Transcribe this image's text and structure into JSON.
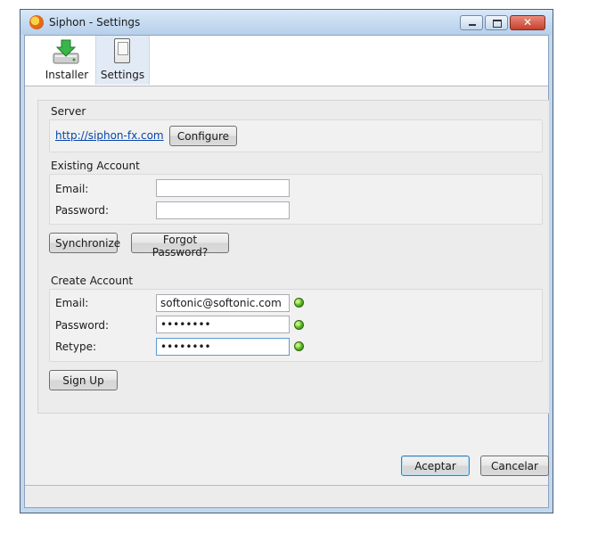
{
  "window": {
    "title": "Siphon - Settings"
  },
  "toolbar": {
    "installer_label": "Installer",
    "settings_label": "Settings"
  },
  "server": {
    "heading": "Server",
    "url": "http://siphon-fx.com",
    "configure_label": "Configure"
  },
  "existing_account": {
    "heading": "Existing Account",
    "email_label": "Email:",
    "email_value": "",
    "password_label": "Password:",
    "password_value": "",
    "synchronize_label": "Synchronize",
    "forgot_label": "Forgot Password?"
  },
  "create_account": {
    "heading": "Create Account",
    "email_label": "Email:",
    "email_value": "softonic@softonic.com",
    "password_label": "Password:",
    "password_value": "••••••••",
    "retype_label": "Retype:",
    "retype_value": "••••••••",
    "signup_label": "Sign Up",
    "status_color": "#5cb82a"
  },
  "dialog": {
    "accept_label": "Aceptar",
    "cancel_label": "Cancelar"
  },
  "icons": [
    "firefox-app-icon",
    "installer-icon",
    "settings-icon",
    "minimize-icon",
    "maximize-icon",
    "close-icon",
    "valid-status-icon"
  ]
}
